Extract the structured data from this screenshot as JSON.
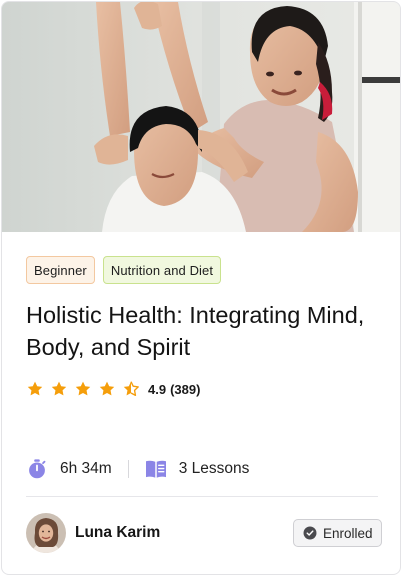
{
  "course": {
    "image_alt": "Instructor helping a student stretch",
    "tags": {
      "level": "Beginner",
      "topic": "Nutrition and Diet"
    },
    "title": "Holistic Health: Integrating Mind, Body, and Spirit",
    "rating": {
      "value": "4.9",
      "count": "(389)",
      "stars": 4.5
    },
    "duration": "6h 34m",
    "lessons": "3 Lessons",
    "instructor": "Luna Karim",
    "status": "Enrolled"
  },
  "colors": {
    "star": "#f59e0b",
    "icon_accent": "#8b85e6",
    "level_tag_bg": "#fdf3e8",
    "topic_tag_bg": "#f1f8df"
  },
  "icons": {
    "duration": "stopwatch-icon",
    "lessons": "book-icon",
    "status": "check-circle-icon"
  }
}
